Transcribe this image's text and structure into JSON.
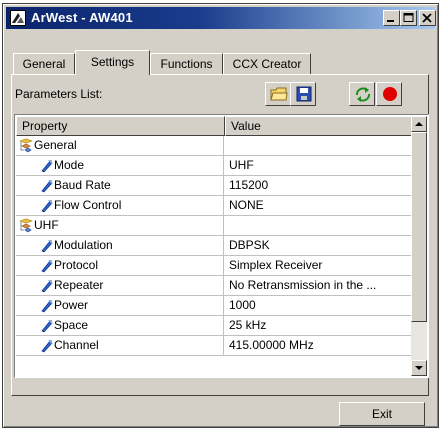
{
  "window": {
    "title": "ArWest - AW401",
    "controls": {
      "minimize_icon": "minimize-icon",
      "maximize_icon": "maximize-icon",
      "close_icon": "close-icon"
    }
  },
  "tabs": [
    {
      "label": "General"
    },
    {
      "label": "Settings",
      "active": true
    },
    {
      "label": "Functions"
    },
    {
      "label": "CCX Creator"
    }
  ],
  "parameters": {
    "label": "Parameters List:",
    "toolbar": [
      {
        "icon": "open-folder-icon"
      },
      {
        "icon": "save-disk-icon"
      },
      {
        "icon": "refresh-arrows-icon"
      },
      {
        "icon": "record-stop-icon",
        "color": "#e00000"
      }
    ]
  },
  "grid": {
    "columns": [
      "Property",
      "Value"
    ],
    "rows": [
      {
        "type": "group",
        "property": "General",
        "value": ""
      },
      {
        "type": "item",
        "property": "Mode",
        "value": "UHF"
      },
      {
        "type": "item",
        "property": "Baud Rate",
        "value": "115200"
      },
      {
        "type": "item",
        "property": "Flow Control",
        "value": "NONE"
      },
      {
        "type": "group",
        "property": "UHF",
        "value": ""
      },
      {
        "type": "item",
        "property": "Modulation",
        "value": "DBPSK"
      },
      {
        "type": "item",
        "property": "Protocol",
        "value": "Simplex Receiver"
      },
      {
        "type": "item",
        "property": "Repeater",
        "value": "No Retransmission in the ..."
      },
      {
        "type": "item",
        "property": "Power",
        "value": "1000"
      },
      {
        "type": "item",
        "property": "Space",
        "value": "25 kHz"
      },
      {
        "type": "item",
        "property": "Channel",
        "value": "415.00000 MHz"
      }
    ]
  },
  "footer": {
    "exit_label": "Exit"
  }
}
